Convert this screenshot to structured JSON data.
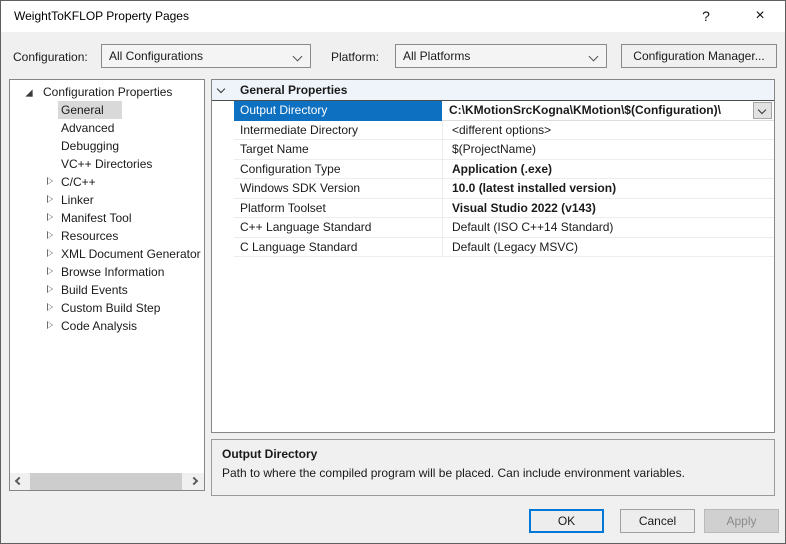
{
  "window": {
    "title": "WeightToKFLOP Property Pages",
    "help_icon": "?",
    "close_icon": "×"
  },
  "toolbar": {
    "configuration_label": "Configuration:",
    "configuration_value": "All Configurations",
    "platform_label": "Platform:",
    "platform_value": "All Platforms",
    "config_manager_label": "Configuration Manager..."
  },
  "tree": {
    "root": {
      "label": "Configuration Properties",
      "expanded": true
    },
    "items": [
      {
        "label": "General",
        "selected": true,
        "has_children": false
      },
      {
        "label": "Advanced",
        "selected": false,
        "has_children": false
      },
      {
        "label": "Debugging",
        "selected": false,
        "has_children": false
      },
      {
        "label": "VC++ Directories",
        "selected": false,
        "has_children": false
      },
      {
        "label": "C/C++",
        "selected": false,
        "has_children": true
      },
      {
        "label": "Linker",
        "selected": false,
        "has_children": true
      },
      {
        "label": "Manifest Tool",
        "selected": false,
        "has_children": true
      },
      {
        "label": "Resources",
        "selected": false,
        "has_children": true
      },
      {
        "label": "XML Document Generator",
        "selected": false,
        "has_children": true
      },
      {
        "label": "Browse Information",
        "selected": false,
        "has_children": true
      },
      {
        "label": "Build Events",
        "selected": false,
        "has_children": true
      },
      {
        "label": "Custom Build Step",
        "selected": false,
        "has_children": true
      },
      {
        "label": "Code Analysis",
        "selected": false,
        "has_children": true
      }
    ]
  },
  "grid": {
    "header": "General Properties",
    "rows": [
      {
        "name": "Output Directory",
        "value": "C:\\KMotionSrcKogna\\KMotion\\$(Configuration)\\",
        "bold": true,
        "selected": true,
        "combo": true
      },
      {
        "name": "Intermediate Directory",
        "value": "<different options>",
        "bold": false,
        "selected": false,
        "combo": false
      },
      {
        "name": "Target Name",
        "value": "$(ProjectName)",
        "bold": false,
        "selected": false,
        "combo": false
      },
      {
        "name": "Configuration Type",
        "value": "Application (.exe)",
        "bold": true,
        "selected": false,
        "combo": false
      },
      {
        "name": "Windows SDK Version",
        "value": "10.0 (latest installed version)",
        "bold": true,
        "selected": false,
        "combo": false
      },
      {
        "name": "Platform Toolset",
        "value": "Visual Studio 2022 (v143)",
        "bold": true,
        "selected": false,
        "combo": false
      },
      {
        "name": "C++ Language Standard",
        "value": "Default (ISO C++14 Standard)",
        "bold": false,
        "selected": false,
        "combo": false
      },
      {
        "name": "C Language Standard",
        "value": "Default (Legacy MSVC)",
        "bold": false,
        "selected": false,
        "combo": false
      }
    ]
  },
  "description": {
    "title": "Output Directory",
    "text": "Path to where the compiled program will be placed. Can include environment variables."
  },
  "buttons": {
    "ok": "OK",
    "cancel": "Cancel",
    "apply": "Apply"
  },
  "colors": {
    "selection_blue": "#0e70c0",
    "focus_border": "#0078d7",
    "tree_selection": "#d9d9d9"
  }
}
